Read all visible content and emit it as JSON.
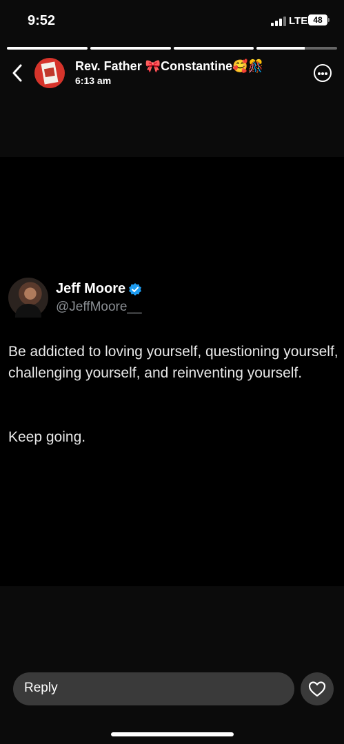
{
  "status": {
    "time": "9:52",
    "network": "LTE",
    "battery": "48"
  },
  "progress": {
    "segments": [
      1,
      1,
      1,
      0.6
    ]
  },
  "story": {
    "author": "Rev. Father 🎀Constantine🥰🎊",
    "time": "6:13 am",
    "icons": [
      "back-icon",
      "more-icon"
    ]
  },
  "post": {
    "name": "Jeff Moore",
    "handle": "@JeffMoore__",
    "text": "Be addicted to loving yourself, questioning yourself, challenging yourself, and reinventing yourself.",
    "text2": "Keep going."
  },
  "reply": {
    "label": "Reply"
  },
  "colors": {
    "background": "#0b0b0b",
    "card": "#000000",
    "verified": "#1d9bf0",
    "input": "#3a3a3a"
  }
}
